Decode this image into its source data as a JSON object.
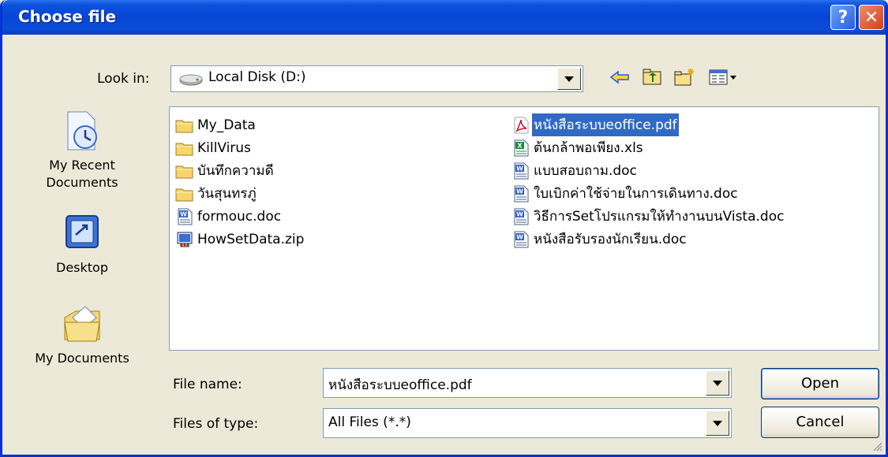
{
  "window": {
    "title": "Choose file"
  },
  "title_buttons": {
    "help": "?",
    "close": "✕"
  },
  "look_in": {
    "label": "Look in:",
    "value": "Local Disk (D:)"
  },
  "toolbar": [
    "back-icon",
    "up-folder-icon",
    "new-folder-icon",
    "view-menu-icon"
  ],
  "places": [
    {
      "label_line1": "My Recent",
      "label_line2": "Documents",
      "icon": "recent-documents-icon"
    },
    {
      "label_line1": "Desktop",
      "label_line2": "",
      "icon": "desktop-icon"
    },
    {
      "label_line1": "My Documents",
      "label_line2": "",
      "icon": "my-documents-icon"
    }
  ],
  "files_left": [
    {
      "name": "My_Data",
      "icon": "folder-icon"
    },
    {
      "name": "KillVirus",
      "icon": "folder-icon"
    },
    {
      "name": "บันทึกความดี",
      "icon": "folder-icon"
    },
    {
      "name": "วันสุนทรภู่",
      "icon": "folder-icon"
    },
    {
      "name": "formouc.doc",
      "icon": "word-doc-icon"
    },
    {
      "name": "HowSetData.zip",
      "icon": "zip-icon"
    }
  ],
  "files_right": [
    {
      "name": "หนังสือระบบeoffice.pdf",
      "icon": "pdf-icon",
      "selected": true
    },
    {
      "name": "ต้นกล้าพอเพียง.xls",
      "icon": "excel-icon"
    },
    {
      "name": "แบบสอบถาม.doc",
      "icon": "word-doc-icon"
    },
    {
      "name": "ใบเบิกค่าใช้จ่ายในการเดินทาง.doc",
      "icon": "word-doc-icon"
    },
    {
      "name": "วิธีการSetโปรแกรมให้ทำงานบนVista.doc",
      "icon": "word-doc-icon"
    },
    {
      "name": "หนังสือรับรองนักเรียน.doc",
      "icon": "word-doc-icon"
    }
  ],
  "file_name": {
    "label": "File name:",
    "value": "หนังสือระบบeoffice.pdf"
  },
  "file_type": {
    "label": "Files of type:",
    "value": "All Files (*.*)"
  },
  "buttons": {
    "open": "Open",
    "cancel": "Cancel"
  },
  "colors": {
    "title_bar": "#0a4dd9",
    "selection": "#316ac5",
    "face": "#ece9d8"
  }
}
